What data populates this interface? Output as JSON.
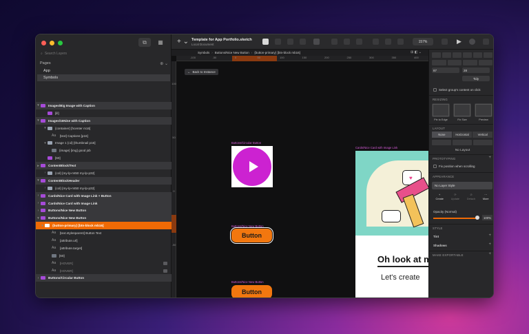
{
  "window": {
    "title": "Template for App Portfolio.sketch",
    "subtitle": "Local Document",
    "zoom": "157%"
  },
  "sidebar": {
    "search_placeholder": "Search Layers",
    "pages_label": "Pages",
    "pages": [
      "App",
      "Symbols"
    ],
    "layers": [
      {
        "label": "Images/Big Image with Caption",
        "kind": "symbol",
        "caret": "▾"
      },
      {
        "label": "[ill]",
        "kind": "sym2",
        "caret": ""
      },
      {
        "label": "Images/16Nine with Caption",
        "kind": "symbol",
        "caret": "▾"
      },
      {
        "label": "{container} [hcenter m16]",
        "kind": "folder",
        "caret": "▾"
      },
      {
        "label": "[text] Captions [p16]",
        "kind": "text",
        "caret": ""
      },
      {
        "label": "Image 1 {cd} [thumbnail p16]",
        "kind": "folder",
        "caret": "▾"
      },
      {
        "label": "{image} [img] good job",
        "kind": "img",
        "caret": ""
      },
      {
        "label": "[60]",
        "kind": "sym2",
        "caret": ""
      },
      {
        "label": "ContentBlock/Text",
        "kind": "symbol",
        "caret": "▸"
      },
      {
        "label": "{col} [my-lp-mt50 my-lp-p32]",
        "kind": "folder",
        "caret": "›"
      },
      {
        "label": "ContentBlockHeader",
        "kind": "symbol",
        "caret": "▾"
      },
      {
        "label": "{col} [my-lp-mt50 my-lp-p32]",
        "kind": "folder",
        "caret": "›"
      },
      {
        "label": "Cards/Nice Card with Image Link + Button",
        "kind": "symbol",
        "caret": "›"
      },
      {
        "label": "Cards/Nice Card with Image Link",
        "kind": "symbol",
        "caret": "›"
      },
      {
        "label": "Buttons/Nice New Button",
        "kind": "symbol",
        "caret": "›"
      },
      {
        "label": "Buttons/Nice New Button",
        "kind": "symbol",
        "caret": "▾"
      },
      {
        "label": "{button-primary} [btn-block mb16]",
        "kind": "selected",
        "caret": "▾"
      },
      {
        "label": "[text.stylesparent] Button Text",
        "kind": "text",
        "caret": ""
      },
      {
        "label": "[attribute.url]",
        "kind": "text",
        "caret": ""
      },
      {
        "label": "[attribute.target]",
        "kind": "text",
        "caret": ""
      },
      {
        "label": "[60]",
        "kind": "img",
        "caret": ""
      },
      {
        "label": "[HOVER]",
        "kind": "text-dim",
        "caret": ""
      },
      {
        "label": "[HOVER]",
        "kind": "text-dim",
        "caret": ""
      },
      {
        "label": "Buttons/Circular Button",
        "kind": "symbol",
        "caret": "›"
      }
    ]
  },
  "canvas": {
    "breadcrumbs": [
      "Symbols",
      "Buttons/Nice New Button",
      "{button-primary} [btn-block mb16]"
    ],
    "back_button": "Back to Instance",
    "ruler_ticks": [
      "-100",
      "-50",
      "0",
      "50",
      "100",
      "150",
      "200",
      "250",
      "300",
      "350",
      "400"
    ],
    "vruler_ticks": [
      "100",
      "50",
      "0",
      "-50"
    ],
    "artboards": {
      "circular_label": "Buttons/Circular Button",
      "card_label": "Cards/Nice Card with Image Link",
      "nice_button_label_1": "Buttons/Nice New Button",
      "nice_button_label_2": "Buttons/Nice New Button"
    },
    "button_text": "Button",
    "card_title": "Oh look at m",
    "card_text": "Let's create"
  },
  "inspector": {
    "x_field": "87",
    "y_field": "28",
    "tidy": "Tidy",
    "select_group": "Select group's content on click",
    "resizing": "RESIZING",
    "thumbs": [
      "Pin to Edge",
      "Fix Size",
      "Preview"
    ],
    "layout": "LAYOUT",
    "layout_seg": [
      "None",
      "Horizontal",
      "Vertical"
    ],
    "no_layout": "No Layout",
    "prototyping": "PROTOTYPING",
    "fix_position": "Fix position when scrolling",
    "appearance": "APPEARANCE",
    "layer_style": "No Layer Style",
    "style_actions": [
      "Create",
      "Update",
      "Detach",
      "More"
    ],
    "opacity_label": "Opacity (Normal)",
    "opacity_value": "100%",
    "opacity": 1.0,
    "style": "STYLE",
    "tint": "Tint",
    "shadows": "Shadows",
    "export": "MAKE EXPORTABLE"
  },
  "colors": {
    "accent": "#f06a05",
    "symbol": "#a64bd8",
    "circle": "#cc22d1",
    "button": "#f2770f"
  }
}
